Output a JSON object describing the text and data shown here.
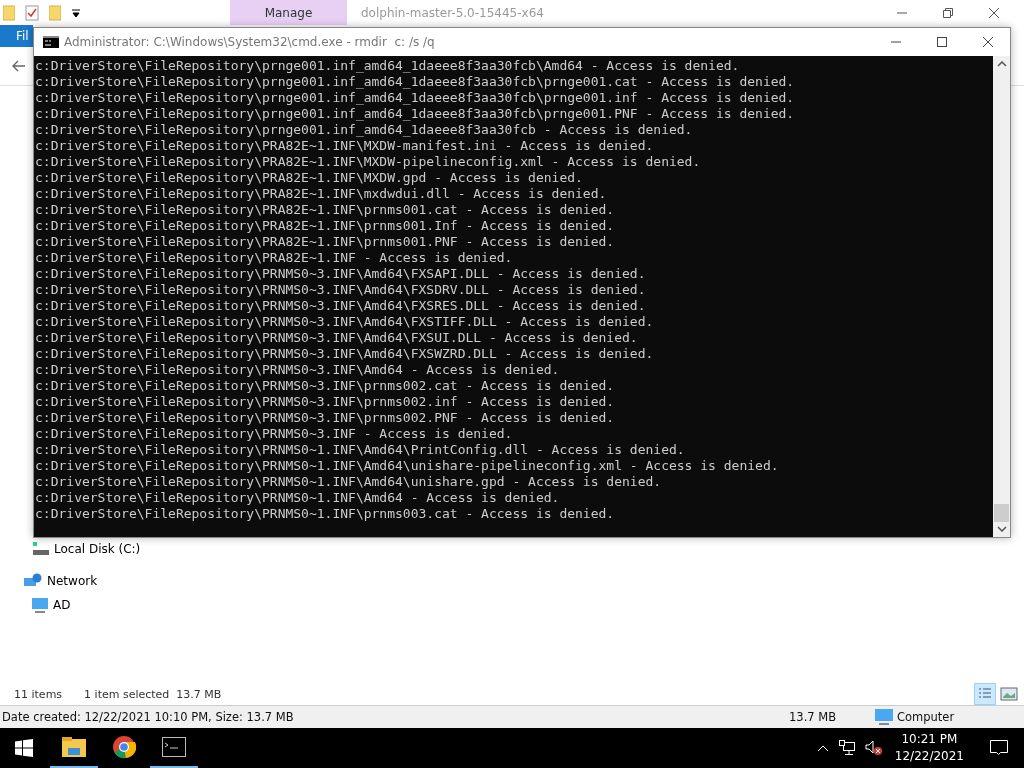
{
  "explorer": {
    "file_tab": "Fil",
    "ribbon_tab": "Manage",
    "title": "dolphin-master-5.0-15445-x64",
    "nav_items": [
      {
        "label": "Local Disk (C:)",
        "kind": "drive"
      },
      {
        "label": "Network",
        "kind": "network"
      },
      {
        "label": "AD",
        "kind": "computer"
      }
    ],
    "status": {
      "count": "11 items",
      "selection": "1 item selected  13.7 MB"
    },
    "details_bar": {
      "info": "Date created: 12/22/2021 10:10 PM, Size: 13.7 MB",
      "size": "13.7 MB",
      "zone": "Computer"
    }
  },
  "console": {
    "title": "Administrator: C:\\Windows\\System32\\cmd.exe - rmdir  c: /s /q",
    "lines": [
      "c:DriverStore\\FileRepository\\prnge001.inf_amd64_1daeee8f3aa30fcb\\Amd64 - Access is denied.",
      "c:DriverStore\\FileRepository\\prnge001.inf_amd64_1daeee8f3aa30fcb\\prnge001.cat - Access is denied.",
      "c:DriverStore\\FileRepository\\prnge001.inf_amd64_1daeee8f3aa30fcb\\prnge001.inf - Access is denied.",
      "c:DriverStore\\FileRepository\\prnge001.inf_amd64_1daeee8f3aa30fcb\\prnge001.PNF - Access is denied.",
      "c:DriverStore\\FileRepository\\prnge001.inf_amd64_1daeee8f3aa30fcb - Access is denied.",
      "c:DriverStore\\FileRepository\\PRA82E~1.INF\\MXDW-manifest.ini - Access is denied.",
      "c:DriverStore\\FileRepository\\PRA82E~1.INF\\MXDW-pipelineconfig.xml - Access is denied.",
      "c:DriverStore\\FileRepository\\PRA82E~1.INF\\MXDW.gpd - Access is denied.",
      "c:DriverStore\\FileRepository\\PRA82E~1.INF\\mxdwdui.dll - Access is denied.",
      "c:DriverStore\\FileRepository\\PRA82E~1.INF\\prnms001.cat - Access is denied.",
      "c:DriverStore\\FileRepository\\PRA82E~1.INF\\prnms001.Inf - Access is denied.",
      "c:DriverStore\\FileRepository\\PRA82E~1.INF\\prnms001.PNF - Access is denied.",
      "c:DriverStore\\FileRepository\\PRA82E~1.INF - Access is denied.",
      "c:DriverStore\\FileRepository\\PRNMS0~3.INF\\Amd64\\FXSAPI.DLL - Access is denied.",
      "c:DriverStore\\FileRepository\\PRNMS0~3.INF\\Amd64\\FXSDRV.DLL - Access is denied.",
      "c:DriverStore\\FileRepository\\PRNMS0~3.INF\\Amd64\\FXSRES.DLL - Access is denied.",
      "c:DriverStore\\FileRepository\\PRNMS0~3.INF\\Amd64\\FXSTIFF.DLL - Access is denied.",
      "c:DriverStore\\FileRepository\\PRNMS0~3.INF\\Amd64\\FXSUI.DLL - Access is denied.",
      "c:DriverStore\\FileRepository\\PRNMS0~3.INF\\Amd64\\FXSWZRD.DLL - Access is denied.",
      "c:DriverStore\\FileRepository\\PRNMS0~3.INF\\Amd64 - Access is denied.",
      "c:DriverStore\\FileRepository\\PRNMS0~3.INF\\prnms002.cat - Access is denied.",
      "c:DriverStore\\FileRepository\\PRNMS0~3.INF\\prnms002.inf - Access is denied.",
      "c:DriverStore\\FileRepository\\PRNMS0~3.INF\\prnms002.PNF - Access is denied.",
      "c:DriverStore\\FileRepository\\PRNMS0~3.INF - Access is denied.",
      "c:DriverStore\\FileRepository\\PRNMS0~1.INF\\Amd64\\PrintConfig.dll - Access is denied.",
      "c:DriverStore\\FileRepository\\PRNMS0~1.INF\\Amd64\\unishare-pipelineconfig.xml - Access is denied.",
      "c:DriverStore\\FileRepository\\PRNMS0~1.INF\\Amd64\\unishare.gpd - Access is denied.",
      "c:DriverStore\\FileRepository\\PRNMS0~1.INF\\Amd64 - Access is denied.",
      "c:DriverStore\\FileRepository\\PRNMS0~1.INF\\prnms003.cat - Access is denied."
    ]
  },
  "taskbar": {
    "apps": [
      {
        "kind": "explorer",
        "running": true
      },
      {
        "kind": "chrome",
        "running": false
      },
      {
        "kind": "console",
        "running": true
      }
    ],
    "time": "10:21 PM",
    "date": "12/22/2021"
  }
}
